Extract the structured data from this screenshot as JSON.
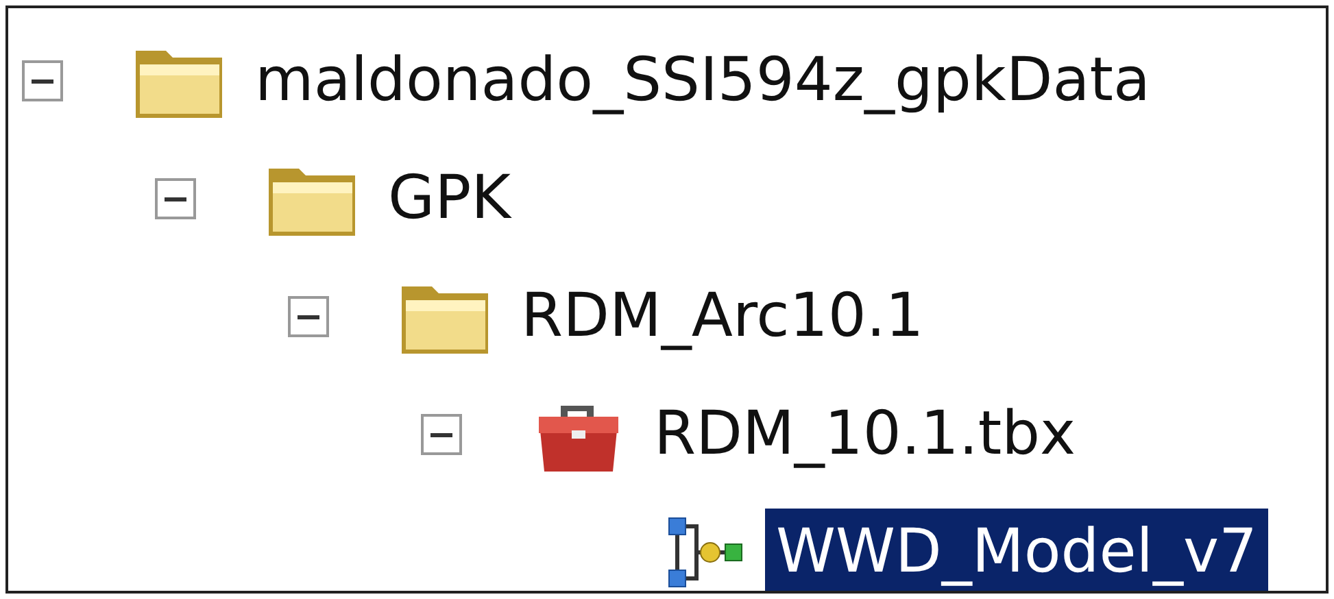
{
  "tree": [
    {
      "label": "maldonado_SSI594z_gpkData",
      "kind": "folder",
      "expanded": true,
      "selected": false,
      "children": [
        {
          "label": "GPK",
          "kind": "folder",
          "expanded": true,
          "selected": false,
          "children": [
            {
              "label": "RDM_Arc10.1",
              "kind": "folder",
              "expanded": true,
              "selected": false,
              "children": [
                {
                  "label": "RDM_10.1.tbx",
                  "kind": "toolbox",
                  "expanded": true,
                  "selected": false,
                  "children": [
                    {
                      "label": "WWD_Model_v7",
                      "kind": "model",
                      "selected": true
                    }
                  ]
                }
              ]
            }
          ]
        }
      ]
    }
  ]
}
